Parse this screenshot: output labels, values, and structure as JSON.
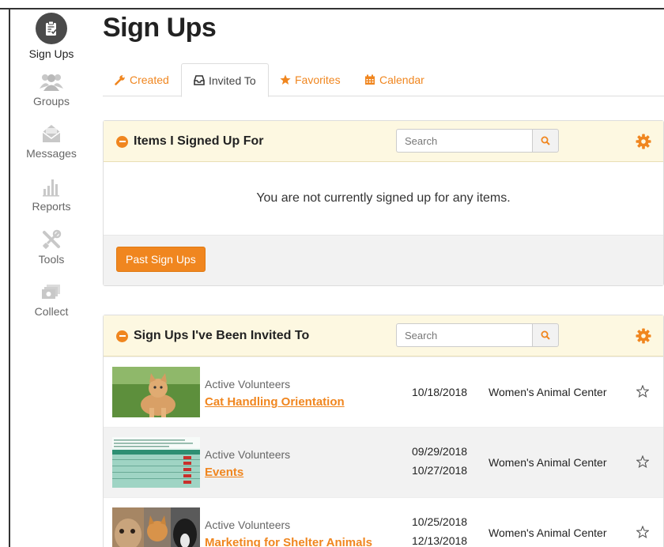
{
  "sidebar": {
    "items": [
      {
        "label": "Sign Ups",
        "icon": "clipboard-icon",
        "active": true
      },
      {
        "label": "Groups",
        "icon": "users-icon"
      },
      {
        "label": "Messages",
        "icon": "envelope-icon"
      },
      {
        "label": "Reports",
        "icon": "bar-chart-icon"
      },
      {
        "label": "Tools",
        "icon": "tools-icon"
      },
      {
        "label": "Collect",
        "icon": "cash-icon"
      }
    ]
  },
  "page": {
    "title": "Sign Ups"
  },
  "tabs": [
    {
      "label": "Created",
      "icon": "wrench-icon"
    },
    {
      "label": "Invited To",
      "icon": "inbox-icon",
      "active": true
    },
    {
      "label": "Favorites",
      "icon": "star-icon"
    },
    {
      "label": "Calendar",
      "icon": "calendar-icon"
    }
  ],
  "signed_up": {
    "title": "Items I Signed Up For",
    "search_placeholder": "Search",
    "empty_message": "You are not currently signed up for any items.",
    "past_button": "Past Sign Ups"
  },
  "invited": {
    "title": "Sign Ups I've Been Invited To",
    "search_placeholder": "Search",
    "rows": [
      {
        "group": "Active Volunteers",
        "title": "Cat Handling Orientation",
        "dates": [
          "10/18/2018"
        ],
        "org": "Women's Animal Center",
        "thumb": "kitten-photo"
      },
      {
        "group": "Active Volunteers",
        "title": "Events",
        "dates": [
          "09/29/2018",
          "10/27/2018"
        ],
        "org": "Women's Animal Center",
        "thumb": "spreadsheet-thumbnail"
      },
      {
        "group": "Active Volunteers",
        "title": "Marketing for Shelter Animals",
        "dates": [
          "10/25/2018",
          "12/13/2018"
        ],
        "org": "Women's Animal Center",
        "thumb": "pets-photo"
      }
    ]
  },
  "colors": {
    "accent": "#f0861f",
    "panel_header": "#fdf8e1",
    "alt_row": "#f2f2f2"
  }
}
